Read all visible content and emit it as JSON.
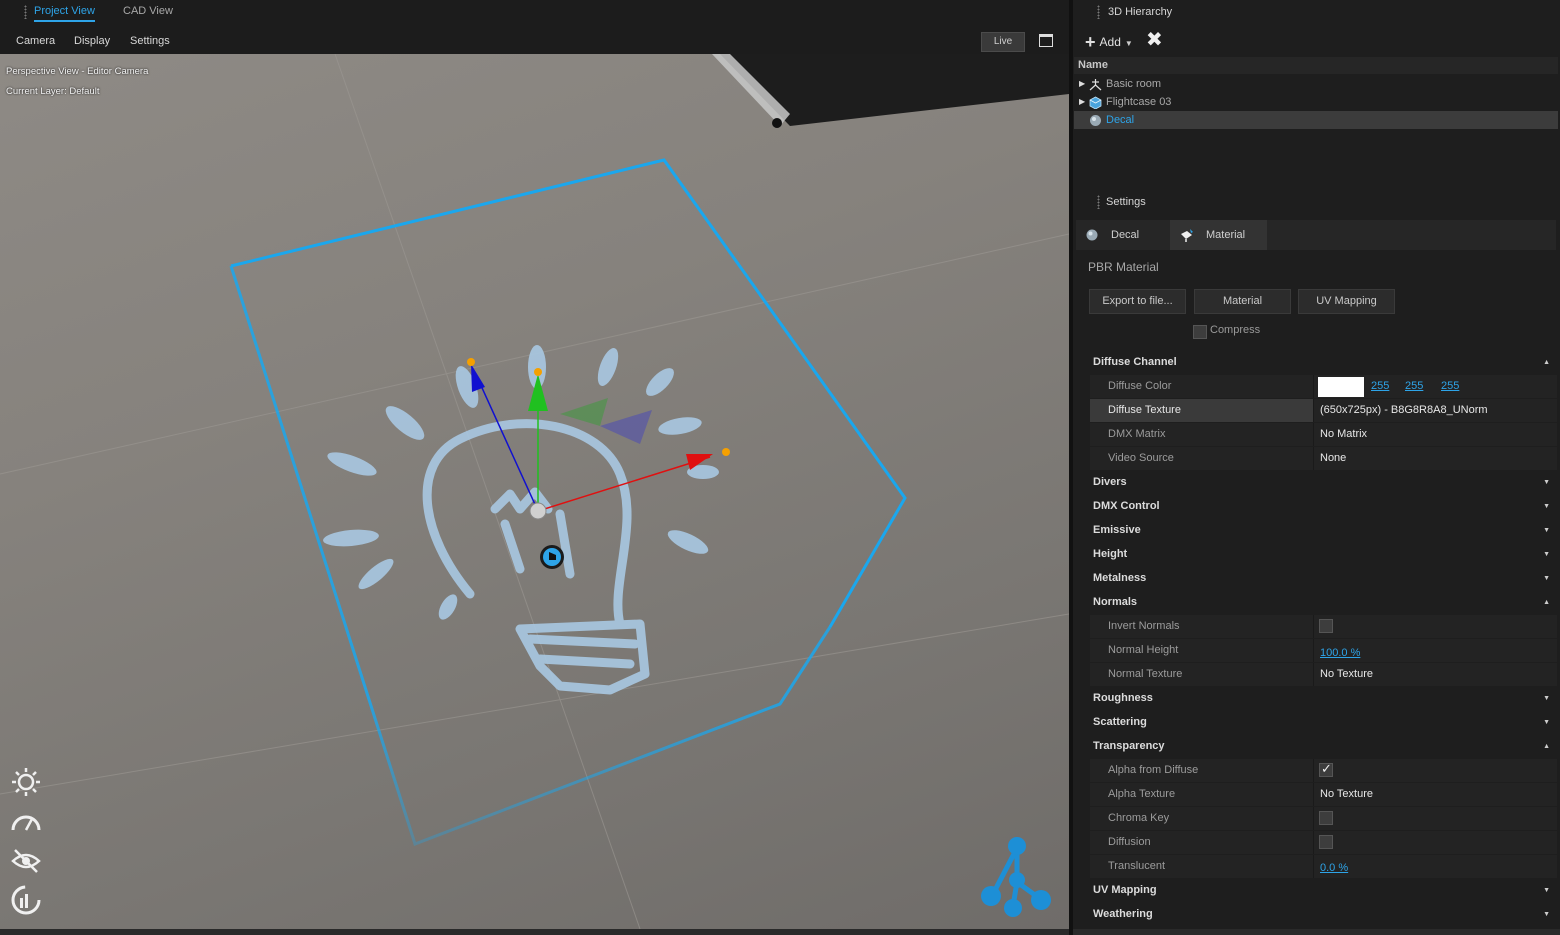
{
  "tabs": {
    "project_view": "Project View",
    "cad_view": "CAD View"
  },
  "menu": {
    "camera": "Camera",
    "display": "Display",
    "settings": "Settings"
  },
  "toolbar": {
    "live": "Live"
  },
  "viewport": {
    "info_line1": "Perspective View - Editor Camera",
    "info_line2": "Current Layer: Default",
    "tools": [
      "sun-icon",
      "speedometer-icon",
      "visibility-icon",
      "performance-gauge-icon"
    ]
  },
  "hierarchy": {
    "title": "3D Hierarchy",
    "add_label": "Add",
    "column_name": "Name",
    "items": [
      {
        "label": "Basic room",
        "icon": "room-icon",
        "expandable": true
      },
      {
        "label": "Flightcase 03",
        "icon": "box-icon",
        "expandable": true
      },
      {
        "label": "Decal",
        "icon": "decal-icon",
        "expandable": false,
        "selected": true
      }
    ]
  },
  "settings": {
    "title": "Settings",
    "tabs": [
      {
        "label": "Decal"
      },
      {
        "label": "Material",
        "active": true
      }
    ],
    "pbr_title": "PBR Material",
    "buttons": {
      "export": "Export to file...",
      "material": "Material",
      "uv_mapping": "UV Mapping"
    },
    "compress_label": "Compress",
    "sections": {
      "diffuse_channel": "Diffuse Channel",
      "divers": "Divers",
      "dmx_control": "DMX Control",
      "emissive": "Emissive",
      "height": "Height",
      "metalness": "Metalness",
      "normals": "Normals",
      "roughness": "Roughness",
      "scattering": "Scattering",
      "transparency": "Transparency",
      "uv_mapping": "UV Mapping",
      "weathering": "Weathering"
    },
    "diffuse": {
      "color_label": "Diffuse Color",
      "color_hex": "#ffffff",
      "r": "255",
      "g": "255",
      "b": "255",
      "texture_label": "Diffuse Texture",
      "texture_value": "(650x725px) - B8G8R8A8_UNorm",
      "dmx_label": "DMX Matrix",
      "dmx_value": "No Matrix",
      "video_label": "Video Source",
      "video_value": "None"
    },
    "normals": {
      "invert_label": "Invert Normals",
      "invert_checked": false,
      "height_label": "Normal Height",
      "height_value": "100.0 %",
      "texture_label": "Normal Texture",
      "texture_value": "No Texture"
    },
    "transparency": {
      "alpha_diffuse_label": "Alpha from Diffuse",
      "alpha_diffuse_checked": true,
      "alpha_texture_label": "Alpha Texture",
      "alpha_texture_value": "No Texture",
      "chroma_label": "Chroma Key",
      "chroma_checked": false,
      "diffusion_label": "Diffusion",
      "diffusion_checked": false,
      "translucent_label": "Translucent",
      "translucent_value": "0.0 %"
    }
  },
  "colors": {
    "accent": "#2ea4e8",
    "selection_frame": "#1aa7ee",
    "decal": "#a9c8e2",
    "gizmo_x": "#e01010",
    "gizmo_y": "#20c020",
    "gizmo_z": "#1010d0"
  }
}
